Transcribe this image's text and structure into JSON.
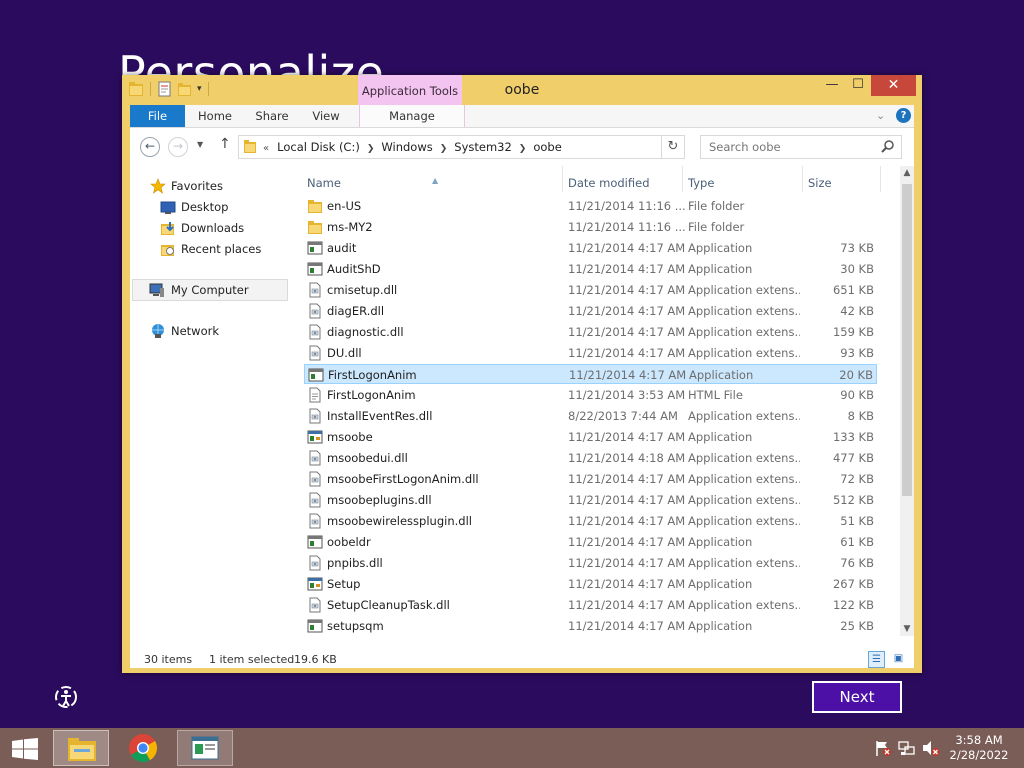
{
  "background_title": "Personalize",
  "window": {
    "title": "oobe",
    "contextual_tab_group": "Application Tools",
    "buttons": {
      "minimize": "—",
      "maximize": "☐",
      "close": "✕"
    }
  },
  "ribbon": {
    "tabs": [
      "File",
      "Home",
      "Share",
      "View",
      "Manage"
    ]
  },
  "address": {
    "lead": "«",
    "crumbs": [
      "Local Disk (C:)",
      "Windows",
      "System32",
      "oobe"
    ],
    "search_placeholder": "Search oobe"
  },
  "navpane": {
    "favorites": "Favorites",
    "favorite_items": [
      "Desktop",
      "Downloads",
      "Recent places"
    ],
    "computer": "My Computer",
    "network": "Network"
  },
  "columns": {
    "name": "Name",
    "date": "Date modified",
    "type": "Type",
    "size": "Size"
  },
  "files": [
    {
      "name": "en-US",
      "date": "11/21/2014 11:16 ...",
      "type": "File folder",
      "size": "",
      "icon": "folder"
    },
    {
      "name": "ms-MY2",
      "date": "11/21/2014 11:16 ...",
      "type": "File folder",
      "size": "",
      "icon": "folder"
    },
    {
      "name": "audit",
      "date": "11/21/2014 4:17 AM",
      "type": "Application",
      "size": "73 KB",
      "icon": "exe"
    },
    {
      "name": "AuditShD",
      "date": "11/21/2014 4:17 AM",
      "type": "Application",
      "size": "30 KB",
      "icon": "exe"
    },
    {
      "name": "cmisetup.dll",
      "date": "11/21/2014 4:17 AM",
      "type": "Application extens...",
      "size": "651 KB",
      "icon": "dll"
    },
    {
      "name": "diagER.dll",
      "date": "11/21/2014 4:17 AM",
      "type": "Application extens...",
      "size": "42 KB",
      "icon": "dll"
    },
    {
      "name": "diagnostic.dll",
      "date": "11/21/2014 4:17 AM",
      "type": "Application extens...",
      "size": "159 KB",
      "icon": "dll"
    },
    {
      "name": "DU.dll",
      "date": "11/21/2014 4:17 AM",
      "type": "Application extens...",
      "size": "93 KB",
      "icon": "dll"
    },
    {
      "name": "FirstLogonAnim",
      "date": "11/21/2014 4:17 AM",
      "type": "Application",
      "size": "20 KB",
      "icon": "exe",
      "selected": true
    },
    {
      "name": "FirstLogonAnim",
      "date": "11/21/2014 3:53 AM",
      "type": "HTML File",
      "size": "90 KB",
      "icon": "html"
    },
    {
      "name": "InstallEventRes.dll",
      "date": "8/22/2013 7:44 AM",
      "type": "Application extens...",
      "size": "8 KB",
      "icon": "dll"
    },
    {
      "name": "msoobe",
      "date": "11/21/2014 4:17 AM",
      "type": "Application",
      "size": "133 KB",
      "icon": "exe2"
    },
    {
      "name": "msoobedui.dll",
      "date": "11/21/2014 4:18 AM",
      "type": "Application extens...",
      "size": "477 KB",
      "icon": "dll"
    },
    {
      "name": "msoobeFirstLogonAnim.dll",
      "date": "11/21/2014 4:17 AM",
      "type": "Application extens...",
      "size": "72 KB",
      "icon": "dll"
    },
    {
      "name": "msoobeplugins.dll",
      "date": "11/21/2014 4:17 AM",
      "type": "Application extens...",
      "size": "512 KB",
      "icon": "dll"
    },
    {
      "name": "msoobewirelessplugin.dll",
      "date": "11/21/2014 4:17 AM",
      "type": "Application extens...",
      "size": "51 KB",
      "icon": "dll"
    },
    {
      "name": "oobeldr",
      "date": "11/21/2014 4:17 AM",
      "type": "Application",
      "size": "61 KB",
      "icon": "exe"
    },
    {
      "name": "pnpibs.dll",
      "date": "11/21/2014 4:17 AM",
      "type": "Application extens...",
      "size": "76 KB",
      "icon": "dll"
    },
    {
      "name": "Setup",
      "date": "11/21/2014 4:17 AM",
      "type": "Application",
      "size": "267 KB",
      "icon": "exe2"
    },
    {
      "name": "SetupCleanupTask.dll",
      "date": "11/21/2014 4:17 AM",
      "type": "Application extens...",
      "size": "122 KB",
      "icon": "dll"
    },
    {
      "name": "setupsqm",
      "date": "11/21/2014 4:17 AM",
      "type": "Application",
      "size": "25 KB",
      "icon": "exe"
    }
  ],
  "status": {
    "count": "30 items",
    "selection": "1 item selected",
    "size": "19.6 KB"
  },
  "next_label": "Next",
  "clock": {
    "time": "3:58 AM",
    "date": "2/28/2022"
  }
}
